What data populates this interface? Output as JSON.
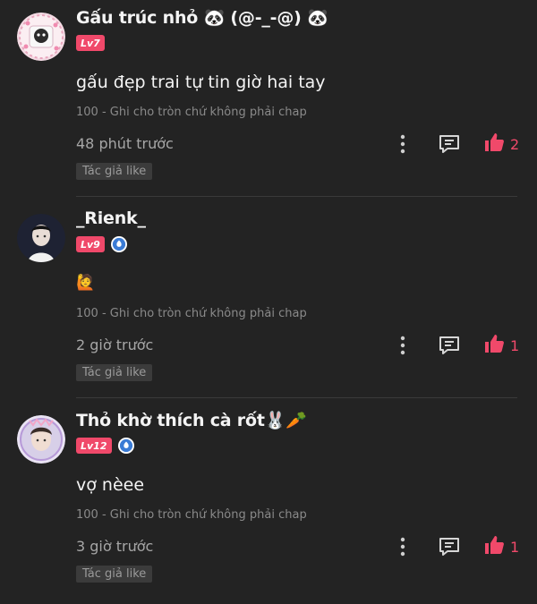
{
  "comments": [
    {
      "username": "Gấu trúc nhỏ 🐼 (@-_-@) 🐼",
      "level": "Lv7",
      "verified": false,
      "content": "gấu đẹp trai tự tin giờ hai tay",
      "chapter": "100 - Ghi cho tròn chứ không phải chap",
      "time": "48 phút trước",
      "likes": "2",
      "author_like": "Tác giả like"
    },
    {
      "username": "_Rienk_",
      "level": "Lv9",
      "verified": true,
      "content": "🙋",
      "chapter": "100 - Ghi cho tròn chứ không phải chap",
      "time": "2 giờ trước",
      "likes": "1",
      "author_like": "Tác giả like"
    },
    {
      "username": "Thỏ khờ thích cà rốt🐰🥕",
      "level": "Lv12",
      "verified": true,
      "content": "vợ nèee",
      "chapter": "100 - Ghi cho tròn chứ không phải chap",
      "time": "3 giờ trước",
      "likes": "1",
      "author_like": "Tác giả like"
    }
  ],
  "icons": {
    "more": "vertical-dots-icon",
    "reply": "reply-icon",
    "like": "thumbs-up-icon",
    "verified": "verified-badge-icon"
  },
  "colors": {
    "background": "#232323",
    "accent": "#f0496a",
    "verify": "#3a7bd5"
  }
}
